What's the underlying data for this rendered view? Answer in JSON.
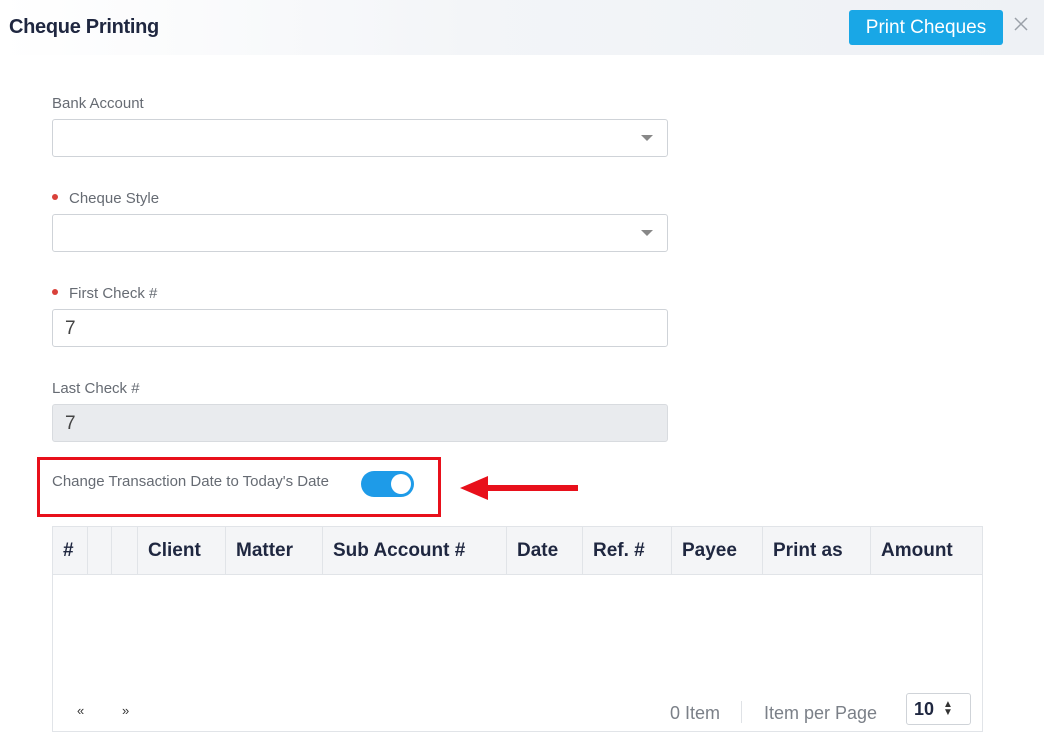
{
  "header": {
    "title": "Cheque Printing",
    "print_button": "Print Cheques",
    "close_icon": "close-icon"
  },
  "form": {
    "bank_account": {
      "label": "Bank Account",
      "value": "",
      "required": false
    },
    "cheque_style": {
      "label": "Cheque Style",
      "value": "",
      "required": true
    },
    "first_check": {
      "label": "First Check #",
      "value": "7",
      "required": true
    },
    "last_check": {
      "label": "Last Check #",
      "value": "7",
      "disabled": true
    },
    "date_toggle": {
      "label": "Change Transaction Date to Today's Date",
      "on": true
    }
  },
  "annotation": {
    "highlight_color": "#e8101b"
  },
  "table": {
    "columns": [
      "#",
      "",
      "",
      "Client",
      "Matter",
      "Sub Account #",
      "Date",
      "Ref. #",
      "Payee",
      "Print as",
      "Amount"
    ],
    "rows": []
  },
  "pagination": {
    "prev": "«",
    "next": "»",
    "item_count": "0 Item",
    "per_page_label": "Item per Page",
    "per_page_value": "10"
  },
  "colors": {
    "accent": "#19a7e6",
    "toggle_on": "#1e9be8",
    "required_dot": "#d9413a"
  }
}
